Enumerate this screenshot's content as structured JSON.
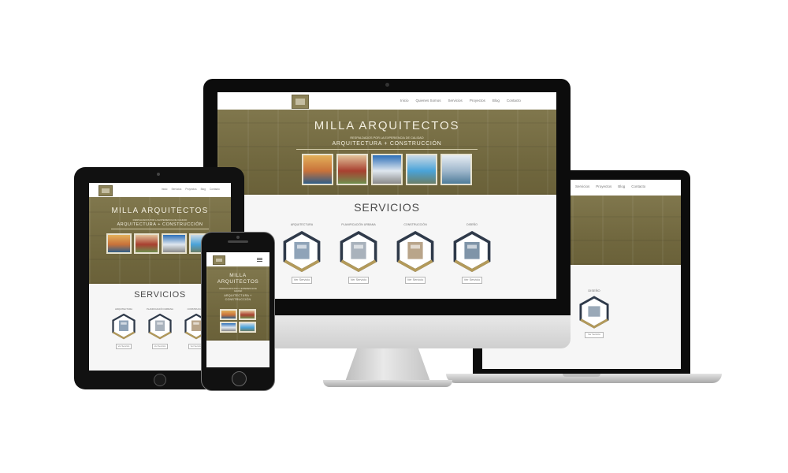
{
  "site": {
    "brand": "MILLA ARQUITECTOS",
    "tagline": "RESPALDADOS POR LA EXPERIENCIA DE CALIDAD",
    "subtitle": "ARQUITECTURA + CONSTRUCCIÓN",
    "nav": [
      "Inicio",
      "Quienes Somos",
      "Servicios",
      "Proyectos",
      "Blog",
      "Contacto"
    ],
    "services_title": "SERVICIOS",
    "services": [
      "ARQUITECTURA",
      "PLANIFICACIÓN URBANA",
      "CONSTRUCCIÓN",
      "DISEÑO"
    ],
    "more_label": "Ver Servicio"
  },
  "colors": {
    "accent": "#8c8258",
    "hero": "#756c43",
    "hex_dark": "#2f3a4a",
    "hex_gold": "#b39a5a",
    "device": "#0c0c0c"
  },
  "thumbnails": [
    {
      "colors": [
        "#c9723a",
        "#e3b05a",
        "#2f5e88"
      ]
    },
    {
      "colors": [
        "#a84030",
        "#e2c29a",
        "#6f8e4e"
      ]
    },
    {
      "colors": [
        "#dfe7ef",
        "#2c6fb8",
        "#8a8a8a"
      ]
    },
    {
      "colors": [
        "#4aa3d8",
        "#c9d9e6",
        "#6a7f6a"
      ]
    },
    {
      "colors": [
        "#9fb7cc",
        "#e6ecf2",
        "#4f7c99"
      ]
    }
  ],
  "icons": [
    "monitor-icon",
    "laptop-icon",
    "tablet-icon",
    "phone-icon",
    "hamburger-menu-icon"
  ]
}
